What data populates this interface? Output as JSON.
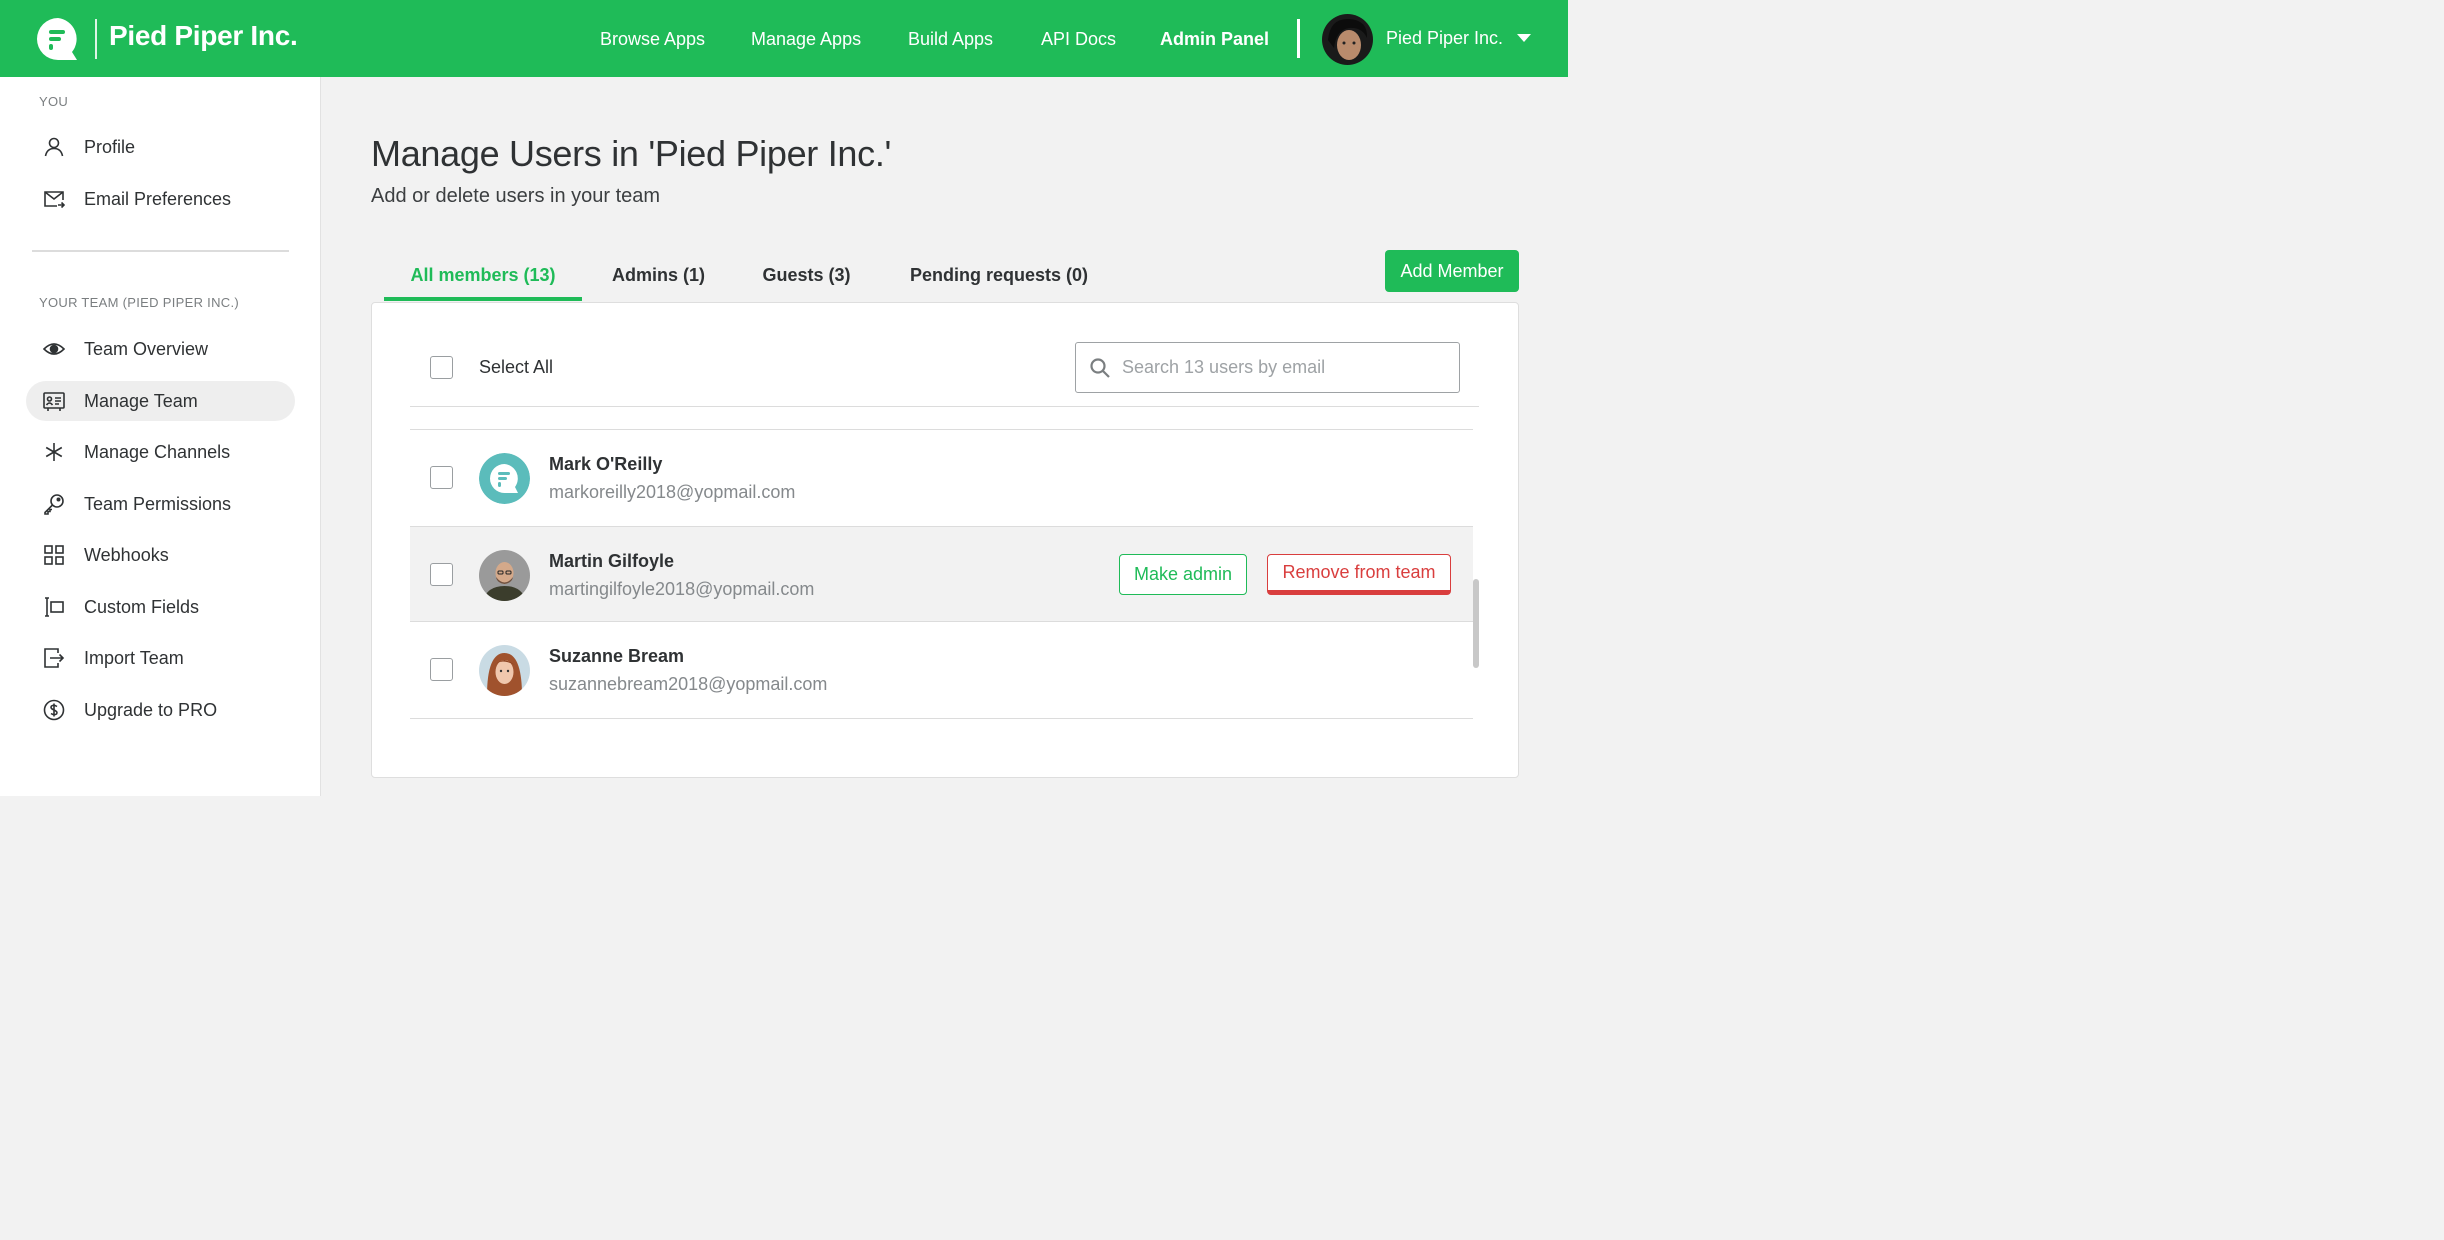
{
  "header": {
    "brand": "Pied Piper Inc.",
    "nav": [
      "Browse Apps",
      "Manage Apps",
      "Build Apps",
      "API Docs",
      "Admin Panel"
    ],
    "active_nav": "Admin Panel",
    "account_name": "Pied Piper Inc.",
    "accent_color": "#1fbb58"
  },
  "sidebar": {
    "you_label": "YOU",
    "you_items": [
      {
        "label": "Profile",
        "icon": "user-icon"
      },
      {
        "label": "Email Preferences",
        "icon": "mail-icon"
      }
    ],
    "team_label": "YOUR TEAM (PIED PIPER INC.)",
    "team_items": [
      {
        "label": "Team Overview",
        "icon": "eye-icon"
      },
      {
        "label": "Manage Team",
        "icon": "id-card-icon",
        "active": true
      },
      {
        "label": "Manage Channels",
        "icon": "snowflake-icon"
      },
      {
        "label": "Team Permissions",
        "icon": "key-icon"
      },
      {
        "label": "Webhooks",
        "icon": "grid-icon"
      },
      {
        "label": "Custom Fields",
        "icon": "custom-fields-icon"
      },
      {
        "label": "Import Team",
        "icon": "import-icon"
      },
      {
        "label": "Upgrade to PRO",
        "icon": "dollar-icon"
      }
    ]
  },
  "main": {
    "title": "Manage Users in 'Pied Piper Inc.'",
    "subtitle": "Add or delete users in your team",
    "tabs": [
      {
        "label": "All members (13)",
        "active": true
      },
      {
        "label": "Admins (1)"
      },
      {
        "label": "Guests (3)"
      },
      {
        "label": "Pending requests (0)"
      }
    ],
    "add_member_label": "Add Member",
    "select_all_label": "Select All",
    "search_placeholder": "Search 13 users by email",
    "users": [
      {
        "name": "Mark O'Reilly",
        "email": "markoreilly2018@yopmail.com",
        "avatar": "app-logo"
      },
      {
        "name": "Martin Gilfoyle",
        "email": "martingilfoyle2018@yopmail.com",
        "avatar": "photo",
        "hover": true
      },
      {
        "name": "Suzanne Bream",
        "email": "suzannebream2018@yopmail.com",
        "avatar": "photo"
      }
    ],
    "row_actions": {
      "make_admin": "Make admin",
      "remove": "Remove from team"
    },
    "danger_color": "#d93e3e"
  }
}
